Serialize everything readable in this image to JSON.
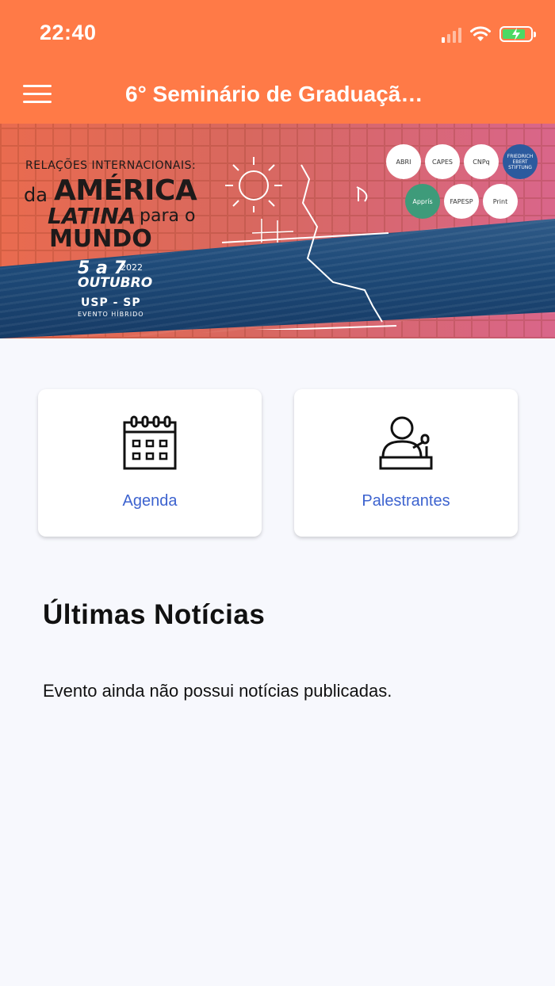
{
  "status_bar": {
    "time": "22:40"
  },
  "header": {
    "title": "6° Seminário de Graduaçã…"
  },
  "banner": {
    "kicker": "RELAÇÕES INTERNACIONAIS:",
    "line_da": "da",
    "line_america": "AMÉRICA",
    "line_latina": "LATINA",
    "line_para": "para o",
    "line_mundo": "MUNDO",
    "date": "5 a 7",
    "year": "2022",
    "month": "OUTUBRO",
    "place": "USP - SP",
    "mode": "EVENTO HÍBRIDO",
    "logos": [
      "ABRI",
      "CAPES",
      "CNPq",
      "FRIEDRICH EBERT STIFTUNG",
      "Apprís",
      "FAPESP",
      "Print"
    ]
  },
  "cards": [
    {
      "label": "Agenda",
      "icon": "calendar-icon"
    },
    {
      "label": "Palestrantes",
      "icon": "speaker-podium-icon"
    }
  ],
  "news": {
    "title": "Últimas Notícias",
    "empty_text": "Evento ainda não possui notícias publicadas."
  },
  "colors": {
    "header": "#ff7a47",
    "link": "#3d63cf",
    "background": "#f7f8fd"
  }
}
